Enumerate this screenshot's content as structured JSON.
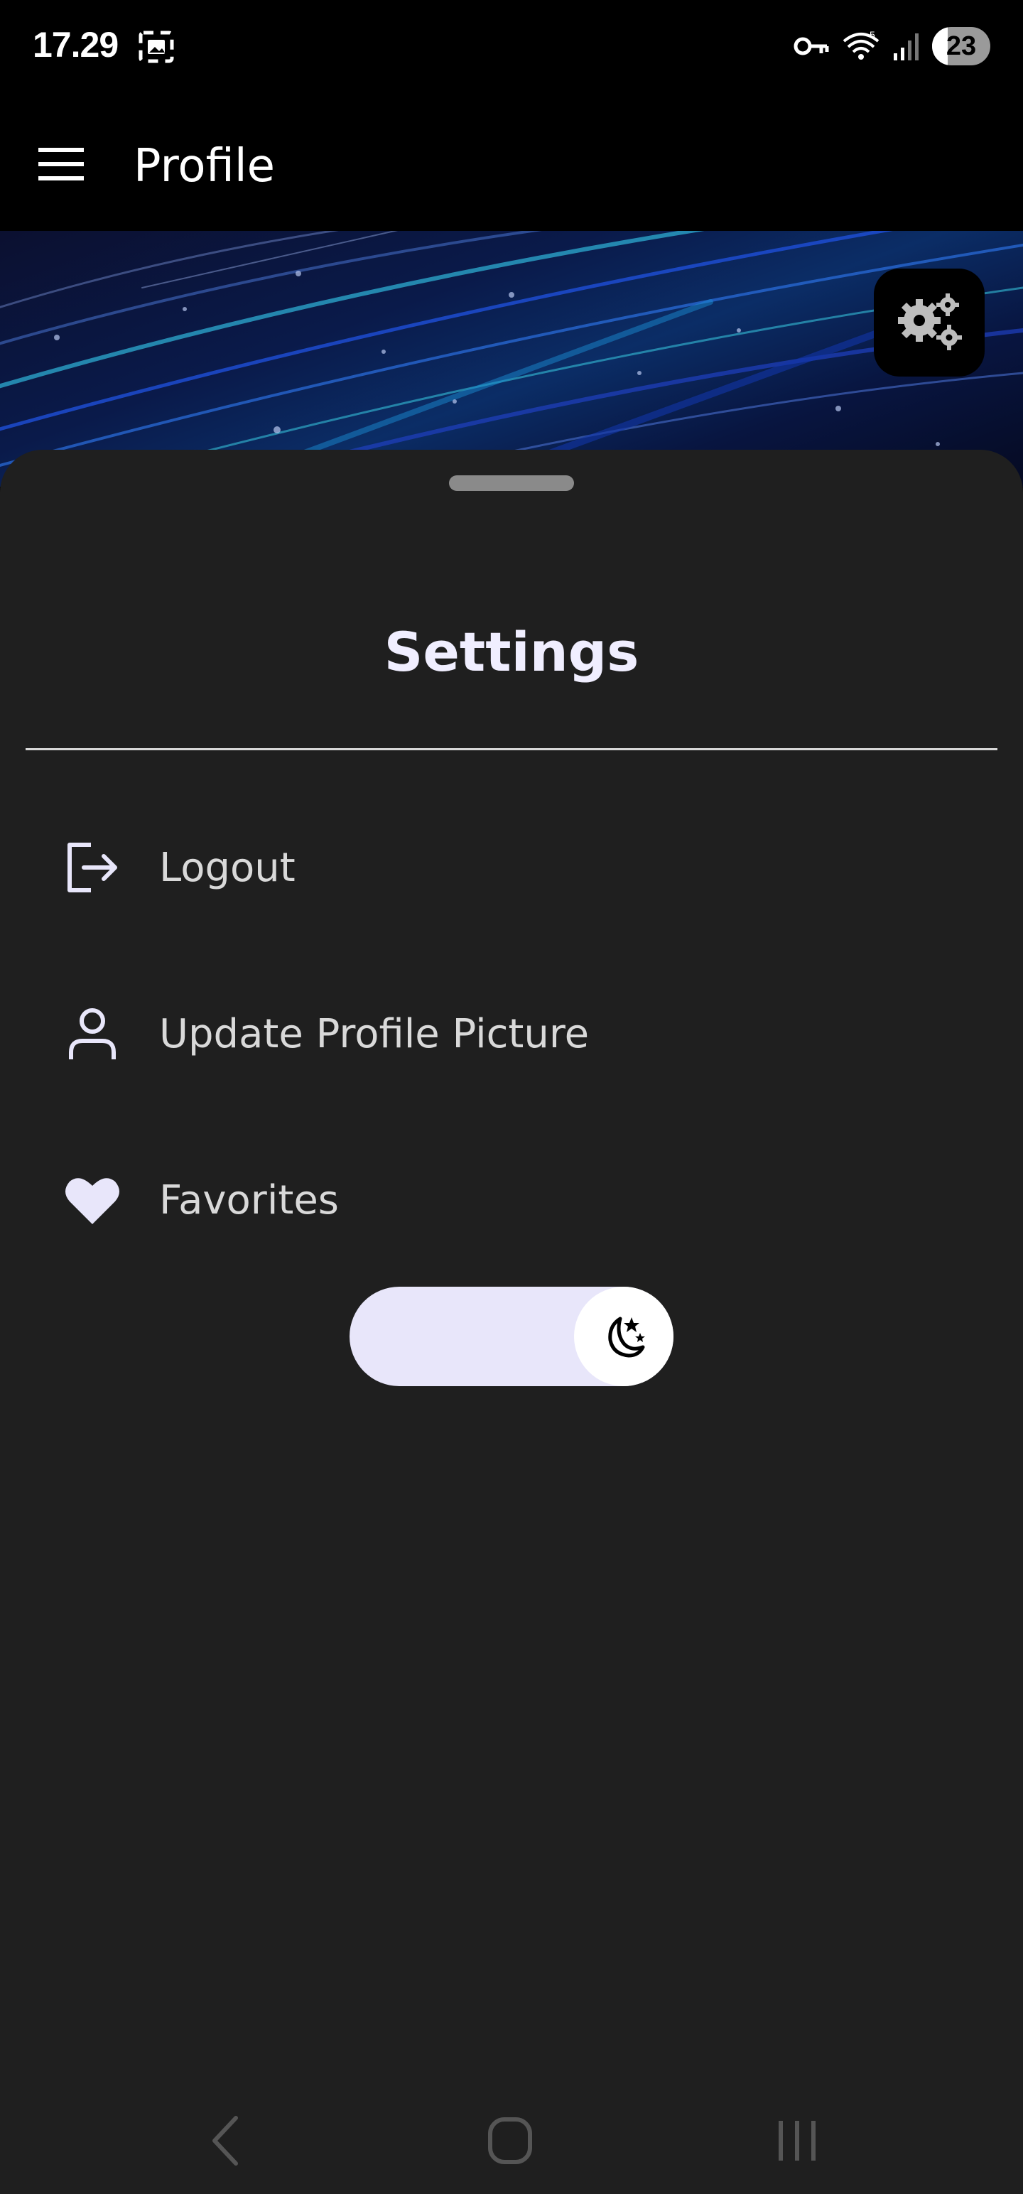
{
  "status_bar": {
    "time": "17.29",
    "battery": "23",
    "icons": [
      "screenshot-icon",
      "key-icon",
      "wifi-icon",
      "signal-icon",
      "battery-icon"
    ]
  },
  "app_bar": {
    "title": "Profile",
    "menu_icon": "hamburger-menu-icon"
  },
  "banner": {
    "fab_icon": "gears-icon"
  },
  "sheet": {
    "title": "Settings",
    "items": [
      {
        "label": "Logout",
        "icon": "logout-icon"
      },
      {
        "label": "Update Profile Picture",
        "icon": "person-icon"
      },
      {
        "label": "Favorites",
        "icon": "heart-icon"
      }
    ],
    "theme_toggle": {
      "icon": "moon-icon",
      "state": "dark"
    }
  },
  "nav_bar": {
    "buttons": [
      "back-icon",
      "home-icon",
      "recents-icon"
    ]
  },
  "colors": {
    "sheet_bg": "#1f1f1f",
    "title": "#f0eeff",
    "item_text": "#d9d9d9",
    "toggle_track": "#e8e6fa"
  }
}
